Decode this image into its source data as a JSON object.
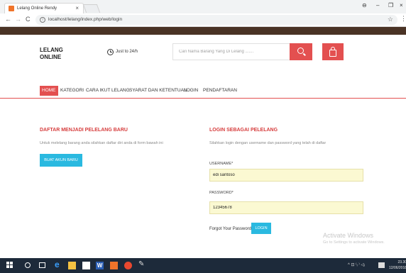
{
  "browser": {
    "tab_title": "Lelang Online Rendy",
    "tab_close": "×",
    "url": "localhost/lelang/index.php/web/login",
    "window_controls": {
      "account": "⊖",
      "minimize": "–",
      "restore": "❐",
      "close": "×"
    },
    "nav": {
      "back": "←",
      "forward": "→",
      "reload": "C"
    },
    "star": "☆",
    "menu": "⋮"
  },
  "header": {
    "logo_line1": "LELANG",
    "logo_line2": "ONLINE",
    "just_label": "Just to 24/h",
    "search_placeholder": "Cari Nama Barang Yang Di Lelang .......",
    "brand_color": "#e35050"
  },
  "menu": {
    "items": [
      {
        "label": "HOME",
        "active": true
      },
      {
        "label": "KATEGORI",
        "active": false
      },
      {
        "label": "CARA IKUT LELANG",
        "active": false
      },
      {
        "label": "SYARAT DAN KETENTUAN",
        "active": false
      },
      {
        "label": "LOGIN",
        "active": false
      },
      {
        "label": "PENDAFTARAN",
        "active": false
      }
    ]
  },
  "register": {
    "title": "DAFTAR MENJADI PELELANG BARU",
    "description": "Untuk melelang barang anda silahkan daftar diri anda di form bawah ini",
    "button_label": "BUAT AKUN BARU"
  },
  "login": {
    "title": "LOGIN SEBAGAI PELELANG",
    "description": "Silahkan login dengan username dan password yang telah di daftar",
    "username_label": "USERNAME*",
    "username_value": "edi santoso",
    "password_label": "PASSWORD*",
    "password_value": "12345678",
    "forgot_label": "Forgot Your Password?",
    "login_button": "LOGIN"
  },
  "watermark": {
    "title": "Activate Windows",
    "subtitle": "Go to Settings to activate Windows."
  },
  "taskbar": {
    "word_letter": "W",
    "edge_letter": "e",
    "tray_text": "^ ⊡ ⁽ᵢ ⁾ ◁ᵢ",
    "time": "23.30",
    "date": "12/06/2018"
  }
}
